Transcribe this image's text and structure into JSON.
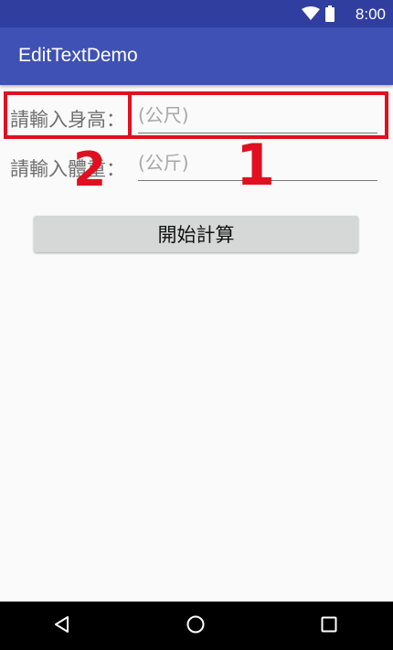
{
  "status_bar": {
    "time": "8:00",
    "icons": [
      "wifi-icon",
      "battery-icon"
    ]
  },
  "app_bar": {
    "title": "EditTextDemo"
  },
  "form": {
    "height_label": "請輸入身高：",
    "height_placeholder": "(公尺)",
    "weight_label": "請輸入體重：",
    "weight_placeholder": "(公斤)",
    "compute_button": "開始計算"
  },
  "annotations": {
    "marker_1": "1",
    "marker_2": "2"
  },
  "nav_bar": {
    "icons": [
      "back-icon",
      "home-icon",
      "recents-icon"
    ]
  },
  "colors": {
    "status_bar": "#303f9f",
    "app_bar": "#3f51b5",
    "annotation": "#e01020",
    "button": "#d6d7d7"
  }
}
